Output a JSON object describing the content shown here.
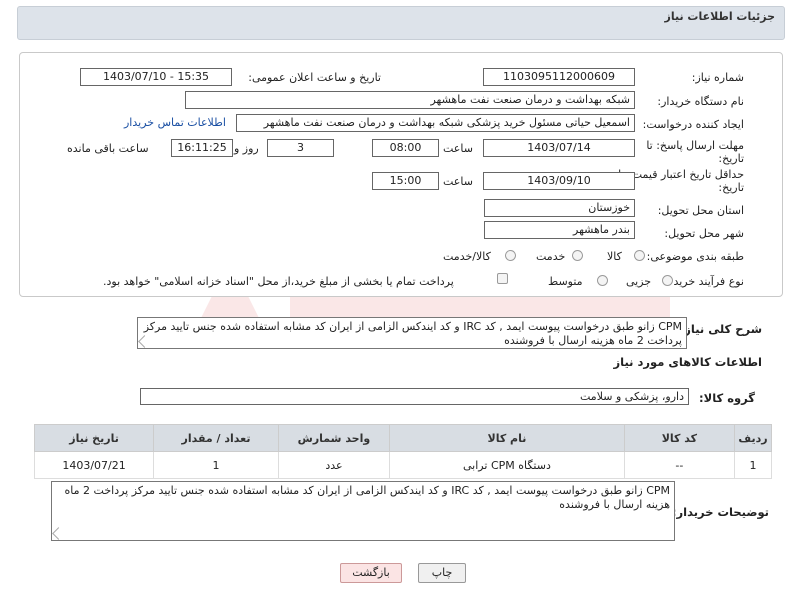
{
  "header": {
    "title": "جزئیات اطلاعات نیاز"
  },
  "form": {
    "need_number_label": "شماره نیاز:",
    "need_number": "1103095112000609",
    "public_date_label": "تاریخ و ساعت اعلان عمومی:",
    "public_date": "1403/07/10 - 15:35",
    "buyer_org_label": "نام دستگاه خریدار:",
    "buyer_org": "شبکه بهداشت و درمان صنعت نفت ماهشهر",
    "creator_label": "ایجاد کننده درخواست:",
    "creator": "اسمعیل حیاتی مسئول خرید پزشکی شبکه بهداشت و درمان صنعت نفت ماهشهر",
    "contact_link": "اطلاعات تماس خریدار",
    "deadline_label_1": "مهلت ارسال پاسخ: تا",
    "deadline_label_2": "تاریخ:",
    "deadline_date": "1403/07/14",
    "time_label": "ساعت",
    "deadline_time": "08:00",
    "days_value": "3",
    "days_label": "روز و",
    "remaining_time": "16:11:25",
    "remaining_label": "ساعت باقی مانده",
    "validity_label_1": "حداقل تاریخ اعتبار قیمت: تا",
    "validity_label_2": "تاریخ:",
    "validity_date": "1403/09/10",
    "validity_time": "15:00",
    "province_label": "استان محل تحویل:",
    "province": "خوزستان",
    "city_label": "شهر محل تحویل:",
    "city": "بندر ماهشهر",
    "category_label": "طبقه بندی موضوعی:",
    "category_options": [
      "کالا",
      "خدمت",
      "کالا/خدمت"
    ],
    "purchase_type_label": "نوع فرآیند خرید :",
    "purchase_options": [
      "جزیی",
      "متوسط"
    ],
    "treasury_note": "پرداخت تمام یا بخشی از مبلغ خرید،از محل \"اسناد خزانه اسلامی\" خواهد بود."
  },
  "description": {
    "label": "شرح کلی نیاز:",
    "text": "CPM زانو طبق درخواست پیوست ایمد , کد IRC و کد ایندکس الزامی از ایران کد مشابه استفاده شده جنس تایید مرکز پرداخت 2 ماه هزینه ارسال با فروشنده"
  },
  "goods": {
    "section_title": "اطلاعات کالاهای مورد نیاز",
    "group_label": "گروه کالا:",
    "group_value": "دارو، پزشکی و سلامت",
    "columns": [
      "ردیف",
      "کد کالا",
      "نام کالا",
      "واحد شمارش",
      "تعداد / مقدار",
      "تاریخ نیاز"
    ],
    "rows": [
      [
        "1",
        "--",
        "دستگاه CPM ترابی",
        "عدد",
        "1",
        "1403/07/21"
      ]
    ]
  },
  "buyer_notes": {
    "label": "توضیحات خریدار:",
    "text": "CPM زانو طبق درخواست پیوست ایمد , کد IRC و کد ایندکس الزامی از ایران کد مشابه استفاده شده جنس تایید مرکز پرداخت 2 ماه هزینه ارسال با فروشنده"
  },
  "buttons": {
    "print": "چاپ",
    "back": "بازگشت"
  },
  "colors": {
    "header_bg": "#dde3ea",
    "table_header_bg": "#d8dde3",
    "link": "#1a4fa3",
    "back_button_bg": "#fbe4e4"
  }
}
